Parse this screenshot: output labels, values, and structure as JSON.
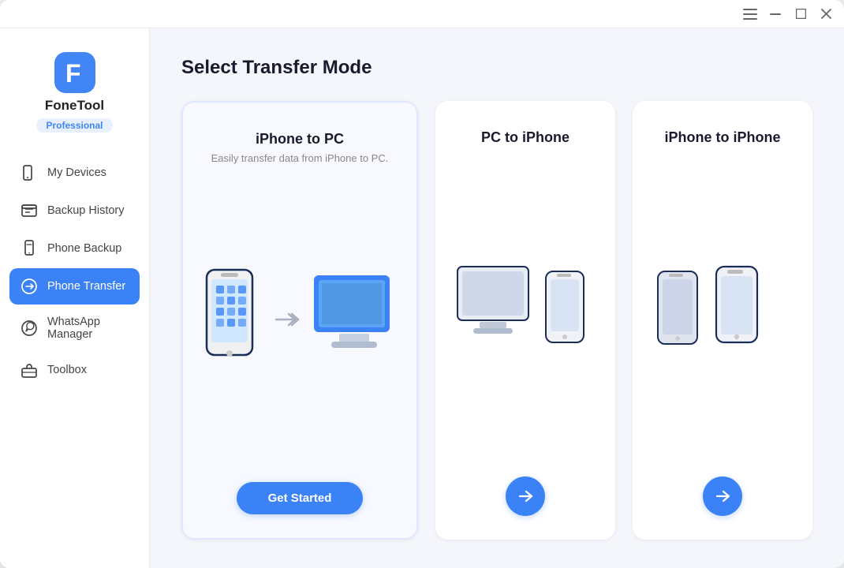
{
  "titlebar": {
    "menu_icon": "☰",
    "minimize_icon": "─",
    "maximize_icon": "□",
    "close_icon": "✕"
  },
  "sidebar": {
    "logo_text": "FoneTool",
    "pro_badge": "Professional",
    "nav_items": [
      {
        "id": "my-devices",
        "label": "My Devices",
        "icon": "device"
      },
      {
        "id": "backup-history",
        "label": "Backup History",
        "icon": "backup"
      },
      {
        "id": "phone-backup",
        "label": "Phone Backup",
        "icon": "phone-backup"
      },
      {
        "id": "phone-transfer",
        "label": "Phone Transfer",
        "icon": "transfer",
        "active": true
      },
      {
        "id": "whatsapp-manager",
        "label": "WhatsApp Manager",
        "icon": "whatsapp"
      },
      {
        "id": "toolbox",
        "label": "Toolbox",
        "icon": "toolbox"
      }
    ]
  },
  "main": {
    "page_title": "Select Transfer Mode",
    "cards": [
      {
        "id": "iphone-to-pc",
        "title": "iPhone to PC",
        "subtitle": "Easily transfer data from iPhone to PC.",
        "action": "get-started",
        "action_label": "Get Started"
      },
      {
        "id": "pc-to-iphone",
        "title": "PC to iPhone",
        "subtitle": "",
        "action": "arrow"
      },
      {
        "id": "iphone-to-iphone",
        "title": "iPhone to iPhone",
        "subtitle": "",
        "action": "arrow"
      }
    ]
  }
}
